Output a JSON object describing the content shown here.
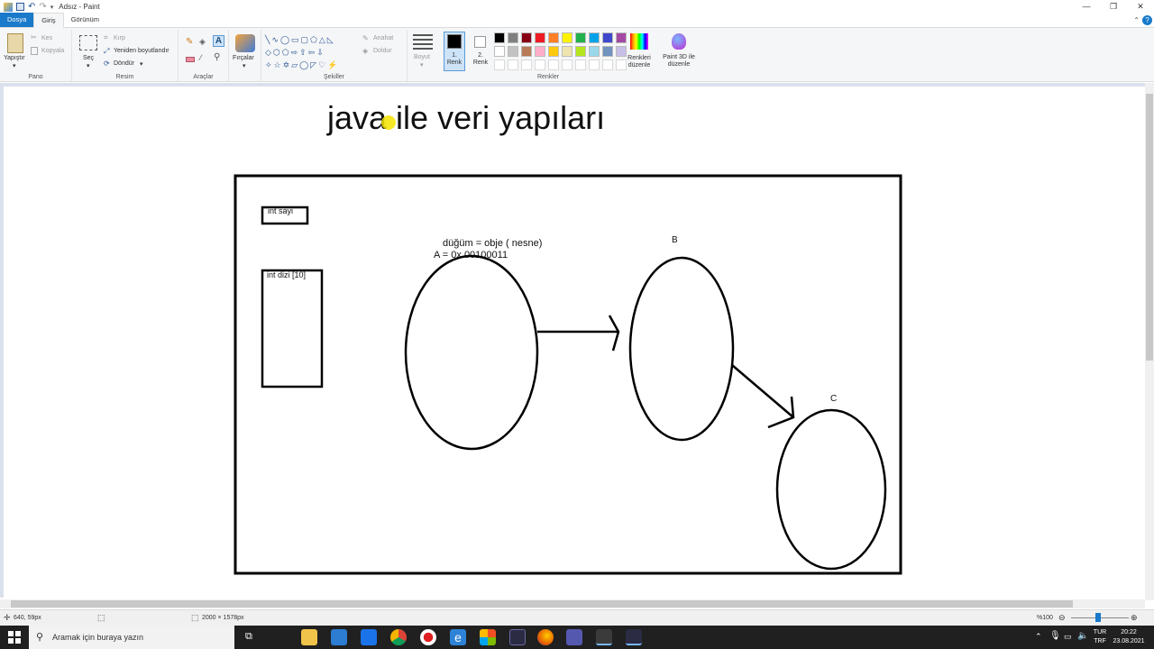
{
  "window": {
    "title": "Adsız - Paint"
  },
  "tabs": {
    "file": "Dosya",
    "home": "Giriş",
    "view": "Görünüm"
  },
  "ribbon": {
    "clipboard": {
      "paste": "Yapıştır",
      "cut": "Kes",
      "copy": "Kopyala",
      "label": "Pano"
    },
    "image": {
      "select": "Seç",
      "crop": "Kırp",
      "resize": "Yeniden boyutlandır",
      "rotate": "Döndür",
      "label": "Resim"
    },
    "tools": {
      "label": "Araçlar"
    },
    "brushes": {
      "label": "Fırçalar"
    },
    "shapes": {
      "outline": "Anahat",
      "fill": "Doldur",
      "label": "Şekiller"
    },
    "size": {
      "label": "Boyut"
    },
    "colors": {
      "color1": "1. Renk",
      "color2": "2. Renk",
      "edit": "Renkleri düzenle",
      "paint3d": "Paint 3D ile düzenle",
      "label": "Renkler",
      "palette_row1": [
        "#000000",
        "#7f7f7f",
        "#880015",
        "#ed1c24",
        "#ff7f27",
        "#fff200",
        "#22b14c",
        "#00a2e8",
        "#3f48cc",
        "#a349a4"
      ],
      "palette_row2": [
        "#ffffff",
        "#c3c3c3",
        "#b97a57",
        "#ffaec9",
        "#ffc90e",
        "#efe4b0",
        "#b5e61d",
        "#99d9ea",
        "#7092be",
        "#c8bfe7"
      ]
    }
  },
  "drawing": {
    "title": "java ile veri yapıları",
    "int_sayi": "int sayi",
    "int_dizi": "int dizi [10]",
    "node_def": "düğüm = obje ( nesne)",
    "node_a": "A = 0x 00100011",
    "label_b": "B",
    "label_c": "C"
  },
  "status": {
    "cursor": "640, 59px",
    "canvas_size": "2000 × 1578px",
    "zoom": "%100"
  },
  "taskbar": {
    "search_placeholder": "Aramak için buraya yazın",
    "lang": "TUR",
    "layout": "TRF",
    "time": "20:22",
    "date": "23.08.2021"
  }
}
